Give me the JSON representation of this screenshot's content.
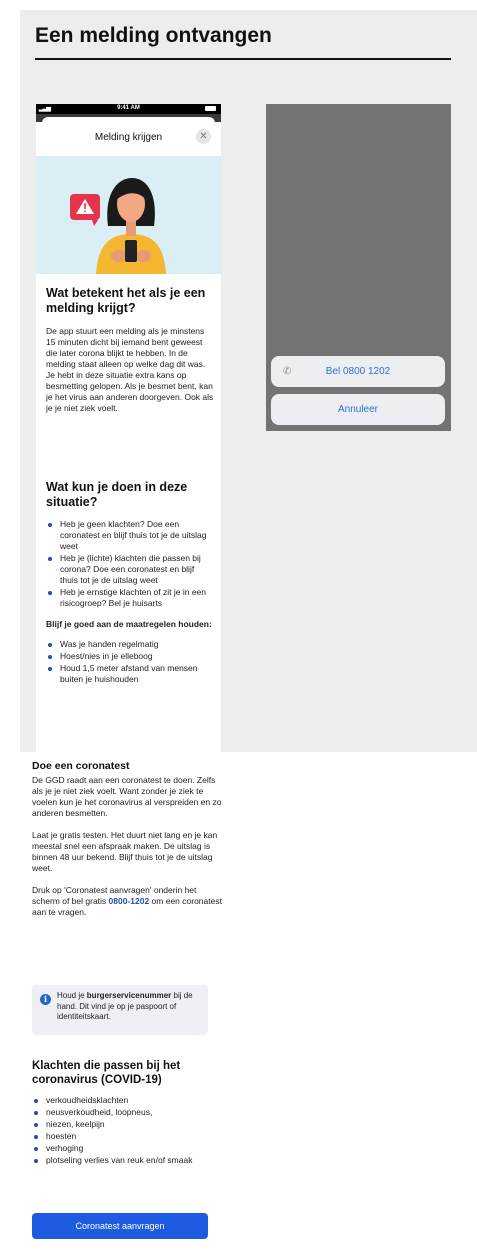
{
  "page_title": "Een melding ontvangen",
  "phone": {
    "status_time": "9:41 AM",
    "modal_title": "Melding krijgen",
    "close_icon": "close-icon",
    "section1": {
      "heading": "Wat betekent het als je een melding krijgt?",
      "body": "De app stuurt een melding als je minstens 15 minuten dicht bij iemand bent geweest die later corona blijkt te hebben. In de melding staat alleen op welke dag dit was. Je hebt in deze situatie extra kans op besmetting gelopen. Als je besmet bent, kan je het virus aan anderen doorgeven. Ook als je je niet ziek voelt."
    },
    "section2": {
      "heading": "Wat kun je doen in deze situatie?",
      "bullets": [
        "Heb je geen klachten? Doe een coronatest en blijf thuis tot je de uitslag weet",
        "Heb je (lichte) klachten die passen bij corona? Doe een coronatest en blijf thuis tot je de uitslag weet",
        "Heb je ernstige klachten of zit je in een risicogroep? Bel je huisarts"
      ],
      "subheading": "Blijf je goed aan de maatregelen houden:",
      "measures": [
        "Was je handen regelmatig",
        "Hoest/nies in je elleboog",
        "Houd 1,5 meter afstand van mensen buiten je huishouden"
      ]
    }
  },
  "actions": {
    "call_label": "Bel 0800 1202",
    "cancel_label": "Annuleer"
  },
  "lower": {
    "heading": "Doe een coronatest",
    "para1": "De GGD raadt aan een coronatest te doen. Zelfs als je je niet ziek voelt. Want zonder je ziek te voelen kun je het coronavirus al verspreiden en zo anderen besmetten.",
    "para2": "Laat je gratis testen. Het duurt niet lang en je kan meestal snel een afspraak maken. De uitslag is binnen 48 uur bekend. Blijf thuis tot je de uitslag weet.",
    "para3_before": "Druk op 'Coronatest aanvragen' onderin het scherm of bel gratis ",
    "para3_link": "0800-1202",
    "para3_after": " om een coronatest aan te vragen.",
    "info_before": "Houd je ",
    "info_bold": "burgerservicenummer",
    "info_after": " bij de hand. Dit vind je op je paspoort of identiteitskaart.",
    "symptoms_heading": "Klachten die passen bij het coronavirus (COVID-19)",
    "symptoms": [
      "verkoudheidsklachten",
      "neusverkoudheid, loopneus,",
      "niezen, keelpijn",
      "hoesten",
      "verhoging",
      "plotseling verlies van reuk en/of smaak"
    ],
    "cta_label": "Coronatest aanvragen"
  },
  "colors": {
    "accent_blue": "#1e5be0",
    "bullet_blue": "#1f4fbf",
    "illustration_bg": "#d9eff3",
    "alert_red": "#e5344d"
  }
}
